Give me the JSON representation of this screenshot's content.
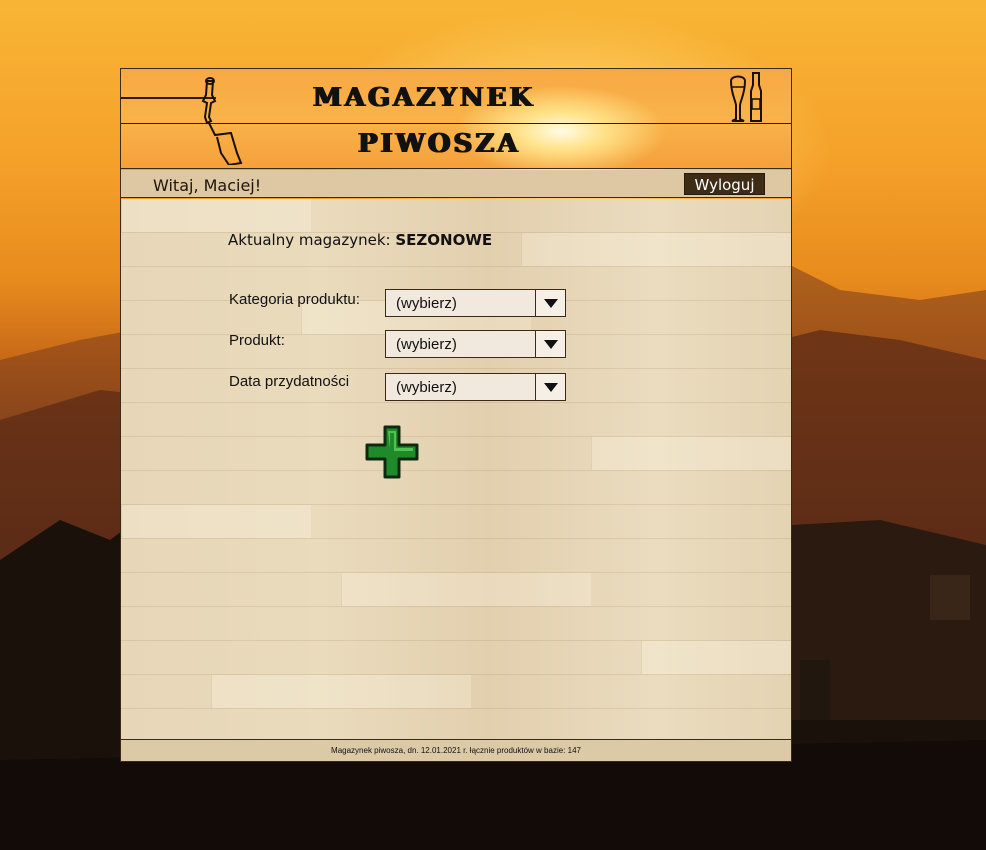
{
  "header": {
    "title_line1": "MAGAZYNEK",
    "title_line2": "PIWOSZA"
  },
  "welcome": {
    "greeting": "Witaj, Maciej!",
    "logout_label": "Wyloguj"
  },
  "warehouse": {
    "label": "Aktualny magazynek:",
    "value": "SEZONOWE"
  },
  "form": {
    "category": {
      "label": "Kategoria produktu:",
      "value": "(wybierz)"
    },
    "product": {
      "label": "Produkt:",
      "value": "(wybierz)"
    },
    "expiry": {
      "label": "Data przydatności",
      "value": "(wybierz)"
    }
  },
  "icons": {
    "add": "plus-icon",
    "tap": "beer-tap-icon",
    "glasses": "beer-glass-bottle-icon",
    "dropdown": "triangle-down-icon"
  },
  "colors": {
    "header_bg": "#f7a844",
    "logout_bg": "#3f2c17",
    "add_green": "#1e8a2a"
  },
  "footer": {
    "text": "Magazynek piwosza, dn. 12.01.2021 r. łącznie produktów w bazie: 147"
  }
}
